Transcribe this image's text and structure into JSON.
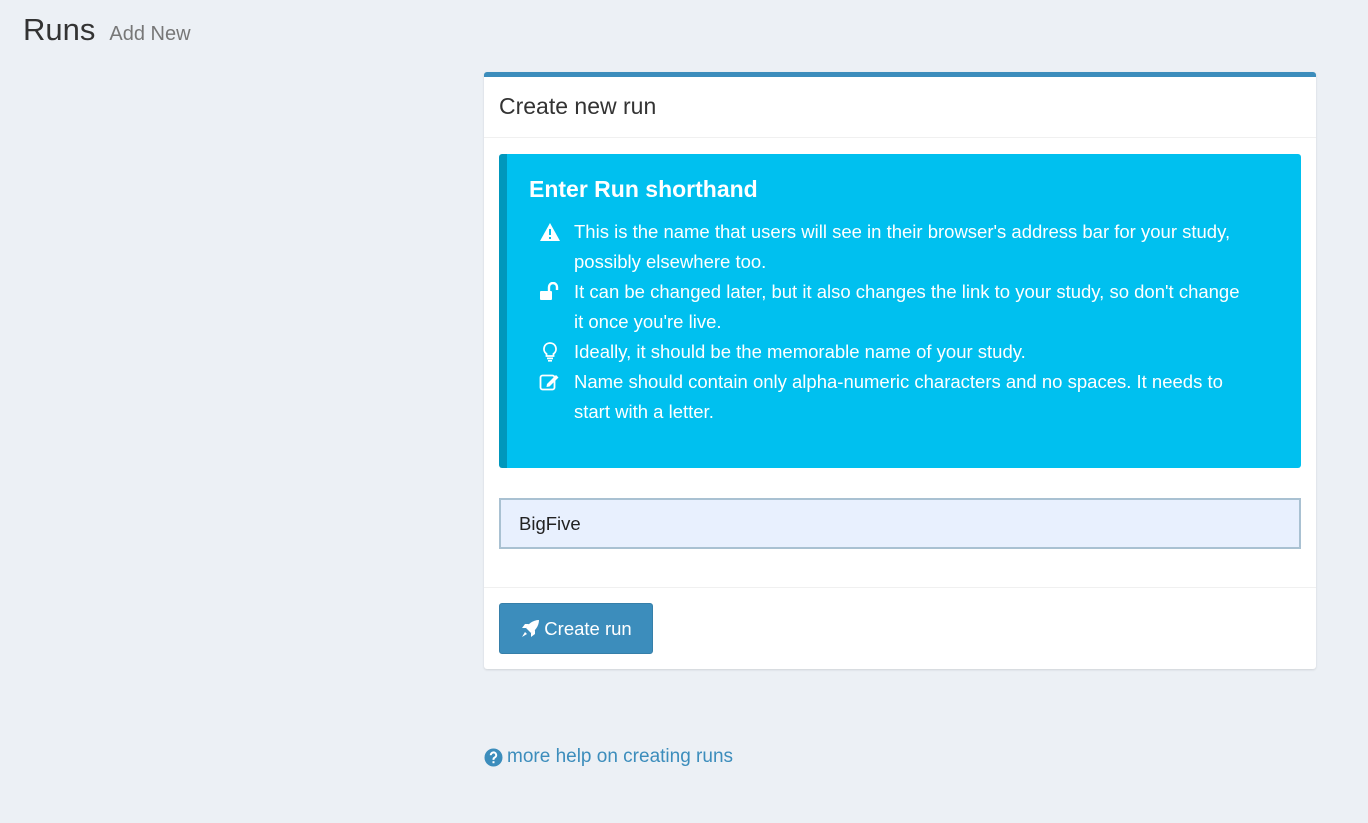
{
  "header": {
    "title": "Runs",
    "subtitle": "Add New"
  },
  "box": {
    "title": "Create new run"
  },
  "callout": {
    "title": "Enter Run shorthand",
    "items": [
      {
        "icon": "warning-icon",
        "text": "This is the name that users will see in their browser's address bar for your study, possibly elsewhere too."
      },
      {
        "icon": "unlock-icon",
        "text": "It can be changed later, but it also changes the link to your study, so don't change it once you're live."
      },
      {
        "icon": "lightbulb-icon",
        "text": "Ideally, it should be the memorable name of your study."
      },
      {
        "icon": "edit-icon",
        "text": "Name should contain only alpha-numeric characters and no spaces. It needs to start with a letter."
      }
    ]
  },
  "form": {
    "run_name_value": "BigFive",
    "submit_icon": "rocket-icon",
    "submit_label": "Create run"
  },
  "help": {
    "icon": "question-circle-icon",
    "link_text": "more help on creating runs"
  },
  "colors": {
    "background": "#ecf0f5",
    "primary": "#3c8dbc",
    "callout_info": "#00c0ef",
    "callout_border": "#0097bc"
  }
}
